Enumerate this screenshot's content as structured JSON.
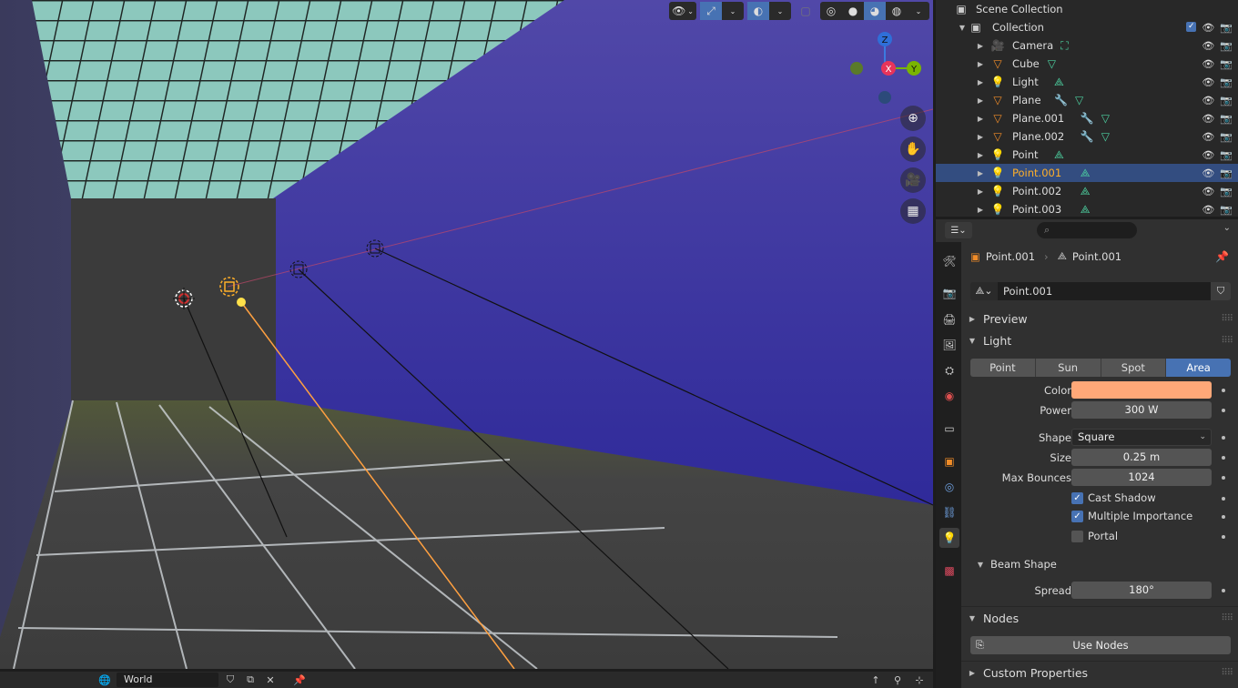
{
  "viewport": {
    "header_buttons": [
      "view-icon",
      "gizmo-icon",
      "overlay-icon",
      "xray-icon",
      "wireframe-icon",
      "solid-icon",
      "material-icon",
      "rendered-icon"
    ],
    "gizmo": {
      "z": "Z",
      "x": "X",
      "y": "Y"
    },
    "colors": {
      "wall_blue": "#3d3a78",
      "ceiling": "#7fbfb4",
      "floor": "#333333",
      "selection": "#ffaf29"
    }
  },
  "bottombar": {
    "world_name": "World"
  },
  "outliner": {
    "root": "Scene Collection",
    "collection": "Collection",
    "items": [
      {
        "label": "Camera",
        "icon": "camera-icon"
      },
      {
        "label": "Cube",
        "icon": "mesh-icon"
      },
      {
        "label": "Light",
        "icon": "light-icon"
      },
      {
        "label": "Plane",
        "icon": "mesh-icon"
      },
      {
        "label": "Plane.001",
        "icon": "mesh-icon"
      },
      {
        "label": "Plane.002",
        "icon": "mesh-icon"
      },
      {
        "label": "Point",
        "icon": "light-icon"
      },
      {
        "label": "Point.001",
        "icon": "light-icon",
        "selected": true
      },
      {
        "label": "Point.002",
        "icon": "light-icon"
      },
      {
        "label": "Point.003",
        "icon": "light-icon"
      }
    ]
  },
  "properties": {
    "search_placeholder": "",
    "breadcrumb": {
      "object": "Point.001",
      "data": "Point.001"
    },
    "datablock_name": "Point.001",
    "panels": {
      "preview": "Preview",
      "light": "Light",
      "beam_shape": "Beam Shape",
      "nodes": "Nodes",
      "custom_properties": "Custom Properties"
    },
    "light_types": [
      "Point",
      "Sun",
      "Spot",
      "Area"
    ],
    "active_light_type": "Area",
    "color_label": "Color",
    "color_value": "#ffa878",
    "power_label": "Power",
    "power_value": "300 W",
    "shape_label": "Shape",
    "shape_value": "Square",
    "size_label": "Size",
    "size_value": "0.25 m",
    "max_bounces_label": "Max Bounces",
    "max_bounces_value": "1024",
    "cast_shadow_label": "Cast Shadow",
    "cast_shadow": true,
    "multiple_importance_label": "Multiple Importance",
    "multiple_importance": true,
    "portal_label": "Portal",
    "portal": false,
    "spread_label": "Spread",
    "spread_value": "180°",
    "use_nodes_label": "Use Nodes"
  }
}
